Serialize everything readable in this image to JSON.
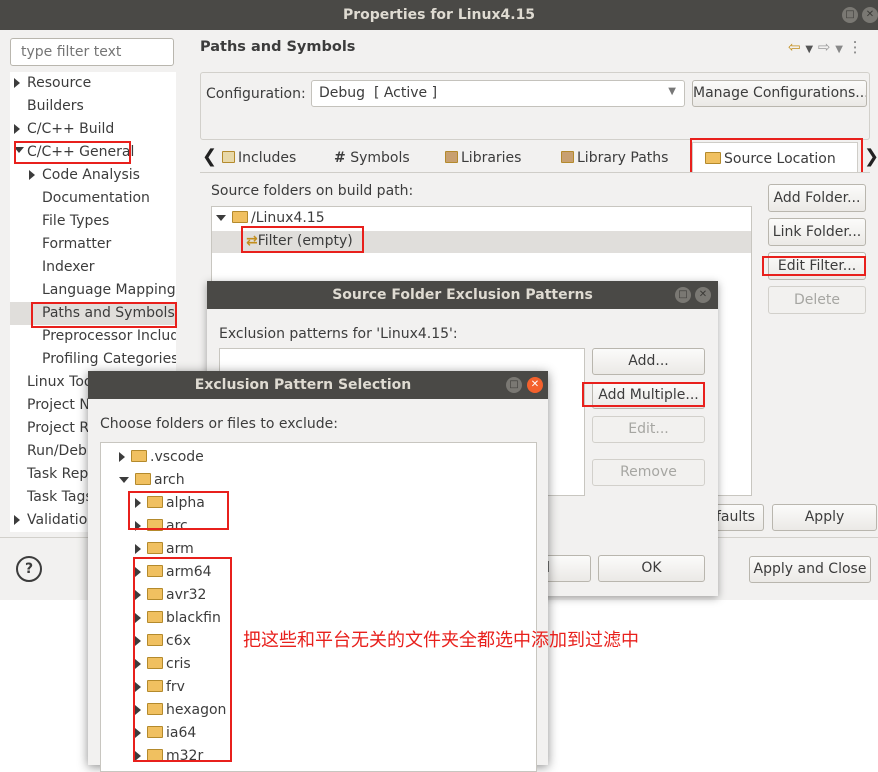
{
  "main_window": {
    "title": "Properties for Linux4.15",
    "filter_placeholder": "type filter text",
    "nav": [
      {
        "label": "Resource",
        "expander": true
      },
      {
        "label": "Builders",
        "expander": false
      },
      {
        "label": "C/C++ Build",
        "expander": true
      },
      {
        "label": "C/C++ General",
        "expander": true,
        "expanded": true
      },
      {
        "label": "Code Analysis",
        "expander": true,
        "child": true
      },
      {
        "label": "Documentation",
        "child": true
      },
      {
        "label": "File Types",
        "child": true
      },
      {
        "label": "Formatter",
        "child": true
      },
      {
        "label": "Indexer",
        "child": true
      },
      {
        "label": "Language Mappings",
        "child": true
      },
      {
        "label": "Paths and Symbols",
        "child": true,
        "selected": true
      },
      {
        "label": "Preprocessor Includ",
        "child": true
      },
      {
        "label": "Profiling Categories",
        "child": true
      },
      {
        "label": "Linux Too"
      },
      {
        "label": "Project N"
      },
      {
        "label": "Project R"
      },
      {
        "label": "Run/Debu"
      },
      {
        "label": "Task Repo"
      },
      {
        "label": "Task Tags"
      },
      {
        "label": "Validatio",
        "expander": true
      }
    ],
    "page_title": "Paths and Symbols",
    "configuration_label": "Configuration:",
    "configuration_value": "Debug  [ Active ]",
    "manage_configurations": "Manage Configurations...",
    "tabs": [
      "Includes",
      "Symbols",
      "Libraries",
      "Library Paths",
      "Source Location"
    ],
    "tab_icons": [
      "#",
      "#",
      "#",
      "#",
      "#"
    ],
    "source_folders_label": "Source folders on build path:",
    "source_tree": {
      "root": "/Linux4.15",
      "filter": "Filter (empty)"
    },
    "side_buttons": {
      "add_folder": "Add Folder...",
      "link_folder": "Link Folder...",
      "edit_filter": "Edit Filter...",
      "delete": "Delete"
    },
    "defaults_button_partial": "faults",
    "apply": "Apply",
    "apply_and_close": "Apply and Close",
    "help": "?"
  },
  "exclusion_patterns_dialog": {
    "title": "Source Folder Exclusion Patterns",
    "label": "Exclusion patterns for 'Linux4.15':",
    "buttons": {
      "add": "Add...",
      "add_multiple": "Add Multiple...",
      "edit": "Edit...",
      "remove": "Remove"
    },
    "cancel_partial": "el",
    "ok": "OK"
  },
  "selection_dialog": {
    "title": "Exclusion Pattern Selection",
    "label": "Choose folders or files to exclude:",
    "items": [
      {
        "label": ".vscode",
        "level": 1,
        "expanded": false
      },
      {
        "label": "arch",
        "level": 1,
        "expanded": true
      },
      {
        "label": "alpha",
        "level": 2
      },
      {
        "label": "arc",
        "level": 2
      },
      {
        "label": "arm",
        "level": 2
      },
      {
        "label": "arm64",
        "level": 2
      },
      {
        "label": "avr32",
        "level": 2
      },
      {
        "label": "blackfin",
        "level": 2
      },
      {
        "label": "c6x",
        "level": 2
      },
      {
        "label": "cris",
        "level": 2
      },
      {
        "label": "frv",
        "level": 2
      },
      {
        "label": "hexagon",
        "level": 2
      },
      {
        "label": "ia64",
        "level": 2
      },
      {
        "label": "m32r",
        "level": 2
      }
    ]
  },
  "annotation": {
    "text": "把这些和平台无关的文件夹全都选中添加到过滤中",
    "color": "#e8201c"
  },
  "colors": {
    "titlebar": "#4a4946",
    "selection": "#e0dedb",
    "annotation_red": "#e8201c"
  }
}
